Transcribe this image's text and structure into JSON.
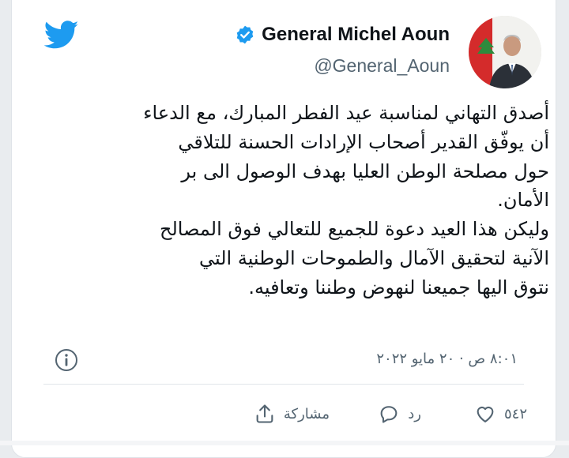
{
  "account": {
    "name": "General Michel Aoun",
    "handle": "@General_Aoun"
  },
  "tweet": {
    "lines": [
      "أصدق التهاني لمناسبة عيد الفطر المبارك، مع الدعاء",
      "أن يوفّق القدير أصحاب الإرادات الحسنة للتلاقي",
      "حول مصلحة الوطن العليا بهدف الوصول الى بر",
      "الأمان.",
      "وليكن هذا العيد دعوة للجميع للتعالي فوق المصالح",
      "الآنية لتحقيق الآمال والطموحات الوطنية التي",
      "نتوق اليها جميعنا لنهوض وطننا وتعافيه."
    ],
    "timestamp": "٨:٠١ ص · ٢٠ مايو ٢٠٢٢"
  },
  "actions": {
    "likes_count": "٥٤٢",
    "reply_label": "رد",
    "share_label": "مشاركة"
  },
  "colors": {
    "accent": "#1d9bf0",
    "text": "#0f1419",
    "secondary": "#536471"
  },
  "icons": {
    "brand": "twitter-bird-icon",
    "verified": "verified-badge-icon",
    "info": "info-icon",
    "like": "heart-icon",
    "reply": "reply-bubble-icon",
    "share": "share-upload-icon"
  }
}
